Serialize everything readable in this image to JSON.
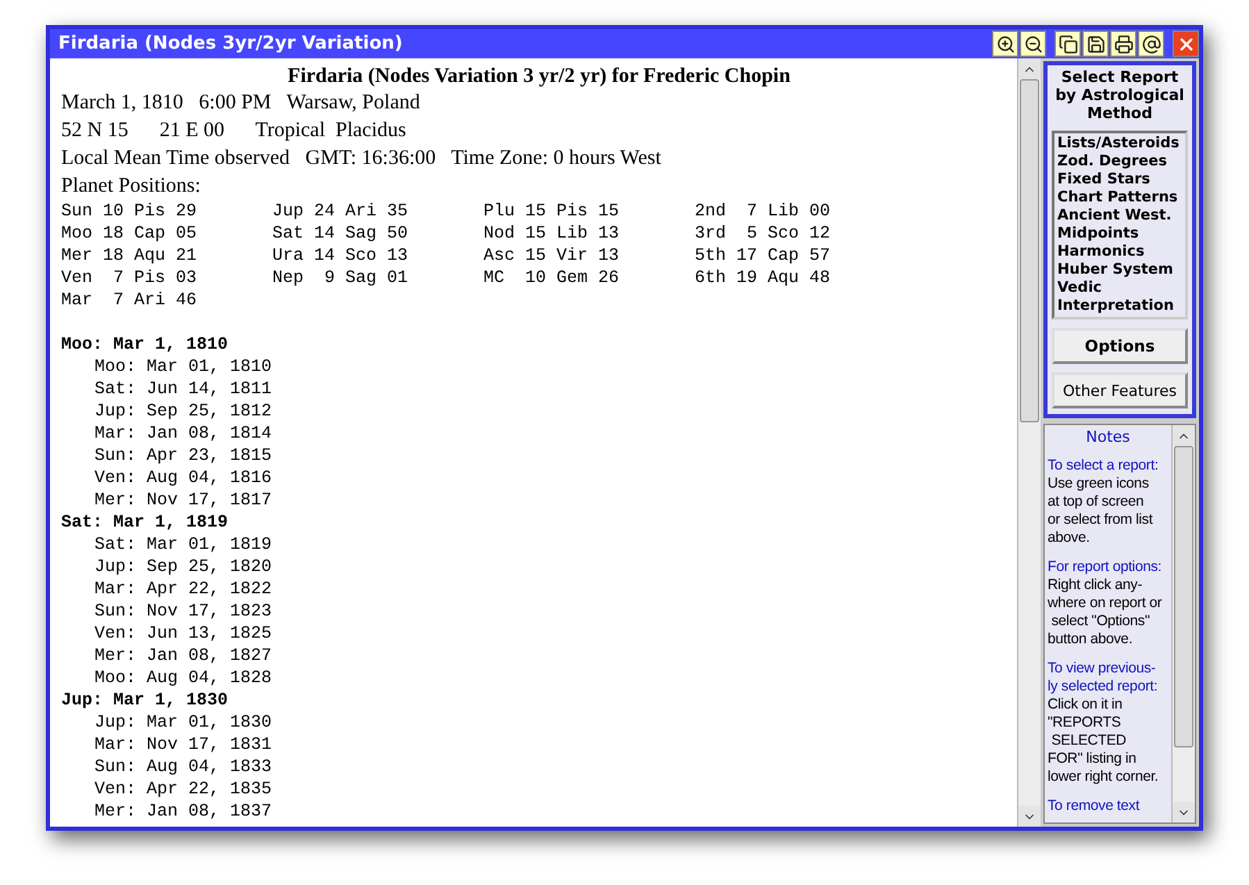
{
  "window": {
    "title": "Firdaria (Nodes 3yr/2yr Variation)"
  },
  "report": {
    "title": "Firdaria (Nodes Variation 3 yr/2 yr) for Frederic Chopin",
    "info_lines": [
      "March 1, 1810   6:00 PM   Warsaw, Poland",
      "52 N 15      21 E 00      Tropical  Placidus",
      "Local Mean Time observed   GMT: 16:36:00   Time Zone: 0 hours West"
    ],
    "positions_label": "Planet Positions:",
    "positions": [
      [
        "Sun 10 Pis 29",
        "Jup 24 Ari 35",
        "Plu 15 Pis 15",
        "2nd  7 Lib 00"
      ],
      [
        "Moo 18 Cap 05",
        "Sat 14 Sag 50",
        "Nod 15 Lib 13",
        "3rd  5 Sco 12"
      ],
      [
        "Mer 18 Aqu 21",
        "Ura 14 Sco 13",
        "Asc 15 Vir 13",
        "5th 17 Cap 57"
      ],
      [
        "Ven  7 Pis 03",
        "Nep  9 Sag 01",
        "MC  10 Gem 26",
        "6th 19 Aqu 48"
      ],
      [
        "Mar  7 Ari 46"
      ]
    ],
    "periods": [
      {
        "heading": "Moo: Mar 1, 1810",
        "subperiods": [
          "Moo: Mar 01, 1810",
          "Sat: Jun 14, 1811",
          "Jup: Sep 25, 1812",
          "Mar: Jan 08, 1814",
          "Sun: Apr 23, 1815",
          "Ven: Aug 04, 1816",
          "Mer: Nov 17, 1817"
        ]
      },
      {
        "heading": "Sat: Mar 1, 1819",
        "subperiods": [
          "Sat: Mar 01, 1819",
          "Jup: Sep 25, 1820",
          "Mar: Apr 22, 1822",
          "Sun: Nov 17, 1823",
          "Ven: Jun 13, 1825",
          "Mer: Jan 08, 1827",
          "Moo: Aug 04, 1828"
        ]
      },
      {
        "heading": "Jup: Mar 1, 1830",
        "subperiods": [
          "Jup: Mar 01, 1830",
          "Mar: Nov 17, 1831",
          "Sun: Aug 04, 1833",
          "Ven: Apr 22, 1835",
          "Mer: Jan 08, 1837"
        ]
      }
    ]
  },
  "side_panel": {
    "heading": "Select Report by Astrological Method",
    "methods": [
      "Lists/Asteroids",
      "Zod. Degrees",
      "Fixed Stars",
      "Chart Patterns",
      "Ancient West.",
      "Midpoints",
      "Harmonics",
      "Huber System",
      "Vedic",
      "Interpretation"
    ],
    "buttons": [
      {
        "label": "Options",
        "bold": true
      },
      {
        "label": "Other Features",
        "bold": false
      }
    ]
  },
  "notes": {
    "title": "Notes",
    "items": [
      {
        "heading": [
          "To select a report:"
        ],
        "body": [
          "Use green icons",
          "at top of screen",
          "or select from list",
          "above."
        ]
      },
      {
        "heading": [
          "For report options:"
        ],
        "body": [
          "Right click any-",
          "where on report or",
          " select \"Options\"",
          "button above."
        ]
      },
      {
        "heading": [
          "To view previous-",
          "ly selected report:"
        ],
        "body": [
          "Click on it in",
          "\"REPORTS",
          " SELECTED",
          "FOR\" listing in",
          "lower right corner."
        ]
      },
      {
        "heading": [
          "To remove text"
        ]
      }
    ]
  }
}
